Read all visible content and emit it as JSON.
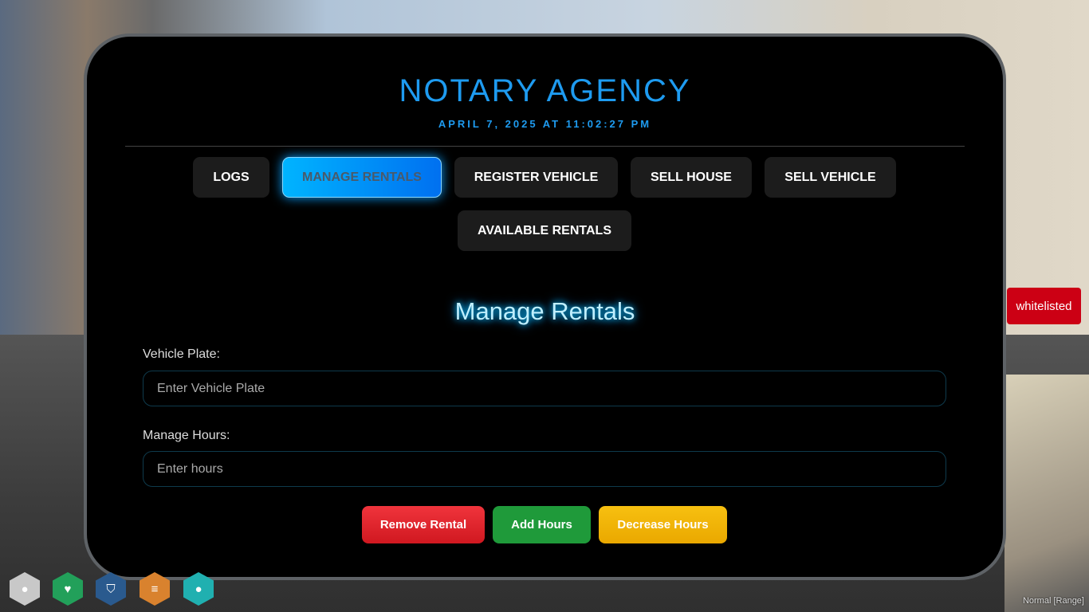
{
  "header": {
    "title": "NOTARY AGENCY",
    "datetime": "APRIL 7, 2025 AT 11:02:27 PM"
  },
  "tabs": [
    {
      "label": "LOGS"
    },
    {
      "label": "MANAGE RENTALS",
      "active": true
    },
    {
      "label": "REGISTER VEHICLE"
    },
    {
      "label": "SELL HOUSE"
    },
    {
      "label": "SELL VEHICLE"
    },
    {
      "label": "AVAILABLE RENTALS"
    }
  ],
  "form": {
    "heading": "Manage Rentals",
    "plate_label": "Vehicle Plate:",
    "plate_placeholder": "Enter Vehicle Plate",
    "plate_value": "",
    "hours_label": "Manage Hours:",
    "hours_placeholder": "Enter hours",
    "hours_value": ""
  },
  "actions": {
    "remove": "Remove Rental",
    "add": "Add Hours",
    "decrease": "Decrease Hours"
  },
  "colors": {
    "accent": "#1e9bf0",
    "remove": "#e0242c",
    "add": "#1f9a3a",
    "decrease": "#f2b20a"
  },
  "hud": {
    "status_badge": "whitelisted",
    "voice_mode": "Normal [Range]",
    "icons": [
      "voice-icon",
      "health-icon",
      "armor-icon",
      "hunger-icon",
      "thirst-icon"
    ]
  }
}
